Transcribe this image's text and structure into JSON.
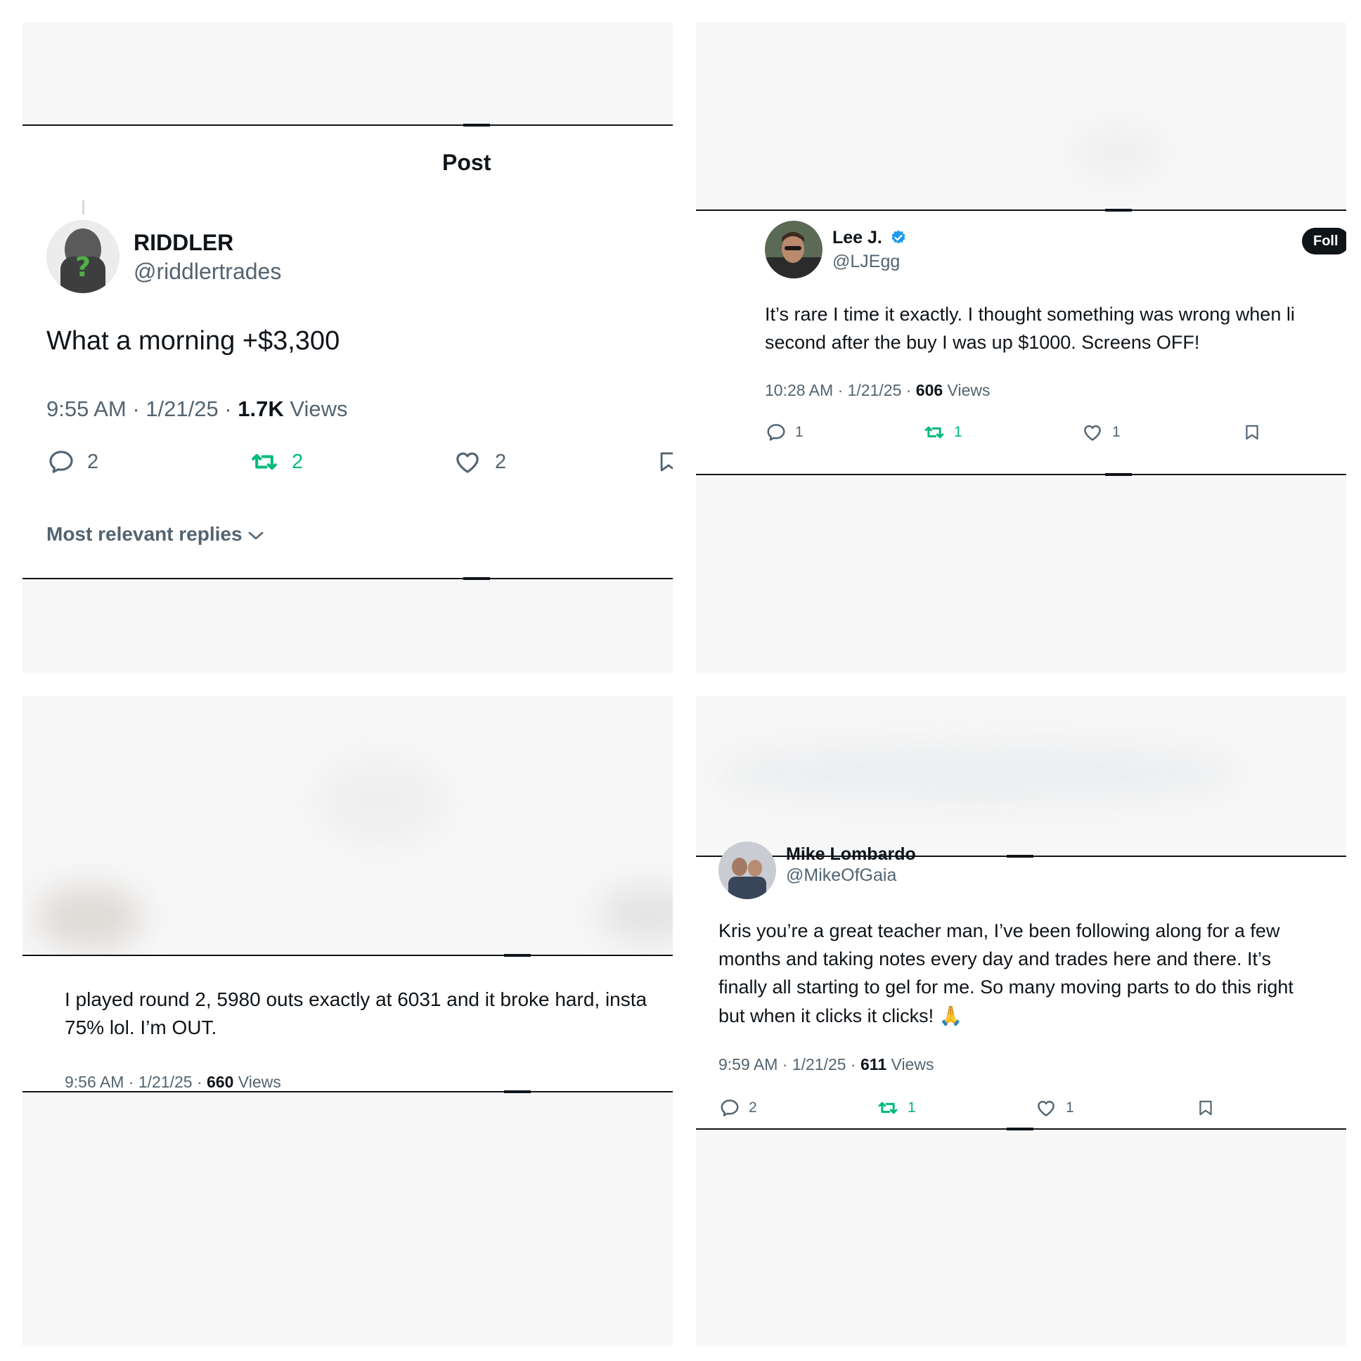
{
  "panel1": {
    "header_title": "Post",
    "author_name": "RIDDLER",
    "author_handle": "@riddlertrades",
    "text": "What a morning +$3,300",
    "meta_time": "9:55 AM · 1/21/25 · ",
    "views_count": "1.7K",
    "views_label": " Views",
    "reply_count": "2",
    "repost_count": "2",
    "like_count": "2",
    "sort_label": "Most relevant replies"
  },
  "panel2": {
    "author_name": "Lee J.",
    "author_handle": "@LJEgg",
    "follow_label": "Foll",
    "text_line1": "It’s rare I time it exactly. I thought something was wrong when li",
    "text_line2": "second after the buy I was up $1000. Screens OFF!",
    "meta_time": "10:28 AM · 1/21/25 · ",
    "views_count": "606",
    "views_label": " Views",
    "reply_count": "1",
    "repost_count": "1",
    "like_count": "1"
  },
  "panel3": {
    "text_line1": "I played round 2, 5980 outs exactly at 6031 and it broke hard, insta",
    "text_line2": "75% lol. I’m OUT.",
    "meta_time": "9:56 AM · 1/21/25 · ",
    "views_count": "660",
    "views_label": " Views"
  },
  "panel4": {
    "author_name": "Mike Lombardo",
    "author_handle": "@MikeOfGaia",
    "text_line1": "Kris you’re a great teacher man, I’ve been following along for a few",
    "text_line2": "months and taking notes every day and trades here and there. It’s",
    "text_line3": "finally all starting to gel for me. So many moving parts to do this right",
    "text_line4": "but when it clicks it clicks! 🙏",
    "meta_time": "9:59 AM · 1/21/25 · ",
    "views_count": "611",
    "views_label": " Views",
    "reply_count": "2",
    "repost_count": "1",
    "like_count": "1"
  },
  "colors": {
    "text": "#0f1419",
    "muted": "#536471",
    "repost_active": "#00ba7c",
    "verified": "#1d9bf0",
    "panel_bg": "#f7f7f7"
  },
  "icons": [
    "reply-icon",
    "repost-icon",
    "like-icon",
    "bookmark-icon",
    "verified-badge-icon",
    "chevron-down-icon"
  ]
}
